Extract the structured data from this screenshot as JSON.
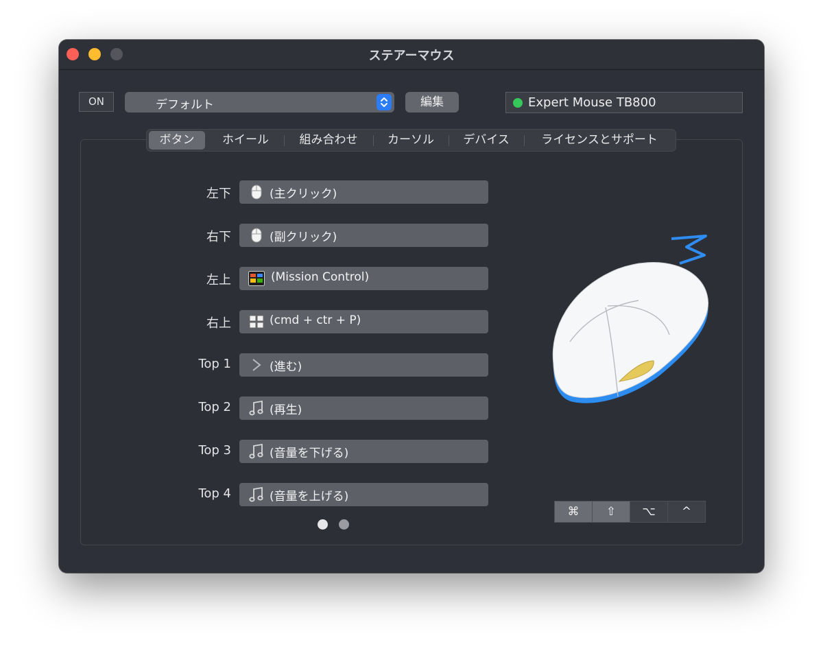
{
  "window": {
    "title": "ステアーマウス"
  },
  "toolbar": {
    "on_label": "ON",
    "profile_selected": "デフォルト",
    "edit_label": "編集",
    "device_name": "Expert Mouse TB800",
    "device_status_color": "#35c759"
  },
  "tabs": [
    {
      "label": "ボタン",
      "active": true
    },
    {
      "label": "ホイール",
      "active": false
    },
    {
      "label": "組み合わせ",
      "active": false
    },
    {
      "label": "カーソル",
      "active": false
    },
    {
      "label": "デバイス",
      "active": false
    },
    {
      "label": "ライセンスとサポート",
      "active": false
    }
  ],
  "buttons": [
    {
      "label": "左下",
      "icon": "mouse-icon",
      "action": "(主クリック)"
    },
    {
      "label": "右下",
      "icon": "mouse-icon",
      "action": "(副クリック)"
    },
    {
      "label": "左上",
      "icon": "mission-control-icon",
      "action": "(Mission Control)"
    },
    {
      "label": "右上",
      "icon": "shortcut-icon",
      "action": "(cmd + ctr + P)"
    },
    {
      "label": "Top 1",
      "icon": "chevron-right-icon",
      "action": "(進む)"
    },
    {
      "label": "Top 2",
      "icon": "music-note-icon",
      "action": "(再生)"
    },
    {
      "label": "Top 3",
      "icon": "music-note-icon",
      "action": "(音量を下げる)"
    },
    {
      "label": "Top 4",
      "icon": "music-note-icon",
      "action": "(音量を上げる)"
    }
  ],
  "pagination": {
    "pages": 2,
    "current": 1
  },
  "modifiers": [
    {
      "symbol": "⌘",
      "name": "command",
      "active": true
    },
    {
      "symbol": "⇧",
      "name": "shift",
      "active": true
    },
    {
      "symbol": "⌥",
      "name": "option",
      "active": false
    },
    {
      "symbol": "^",
      "name": "control",
      "active": false
    }
  ],
  "colors": {
    "accent_blue": "#2a7cf7",
    "window_bg": "#2d3038",
    "field_bg": "#5d6066"
  }
}
